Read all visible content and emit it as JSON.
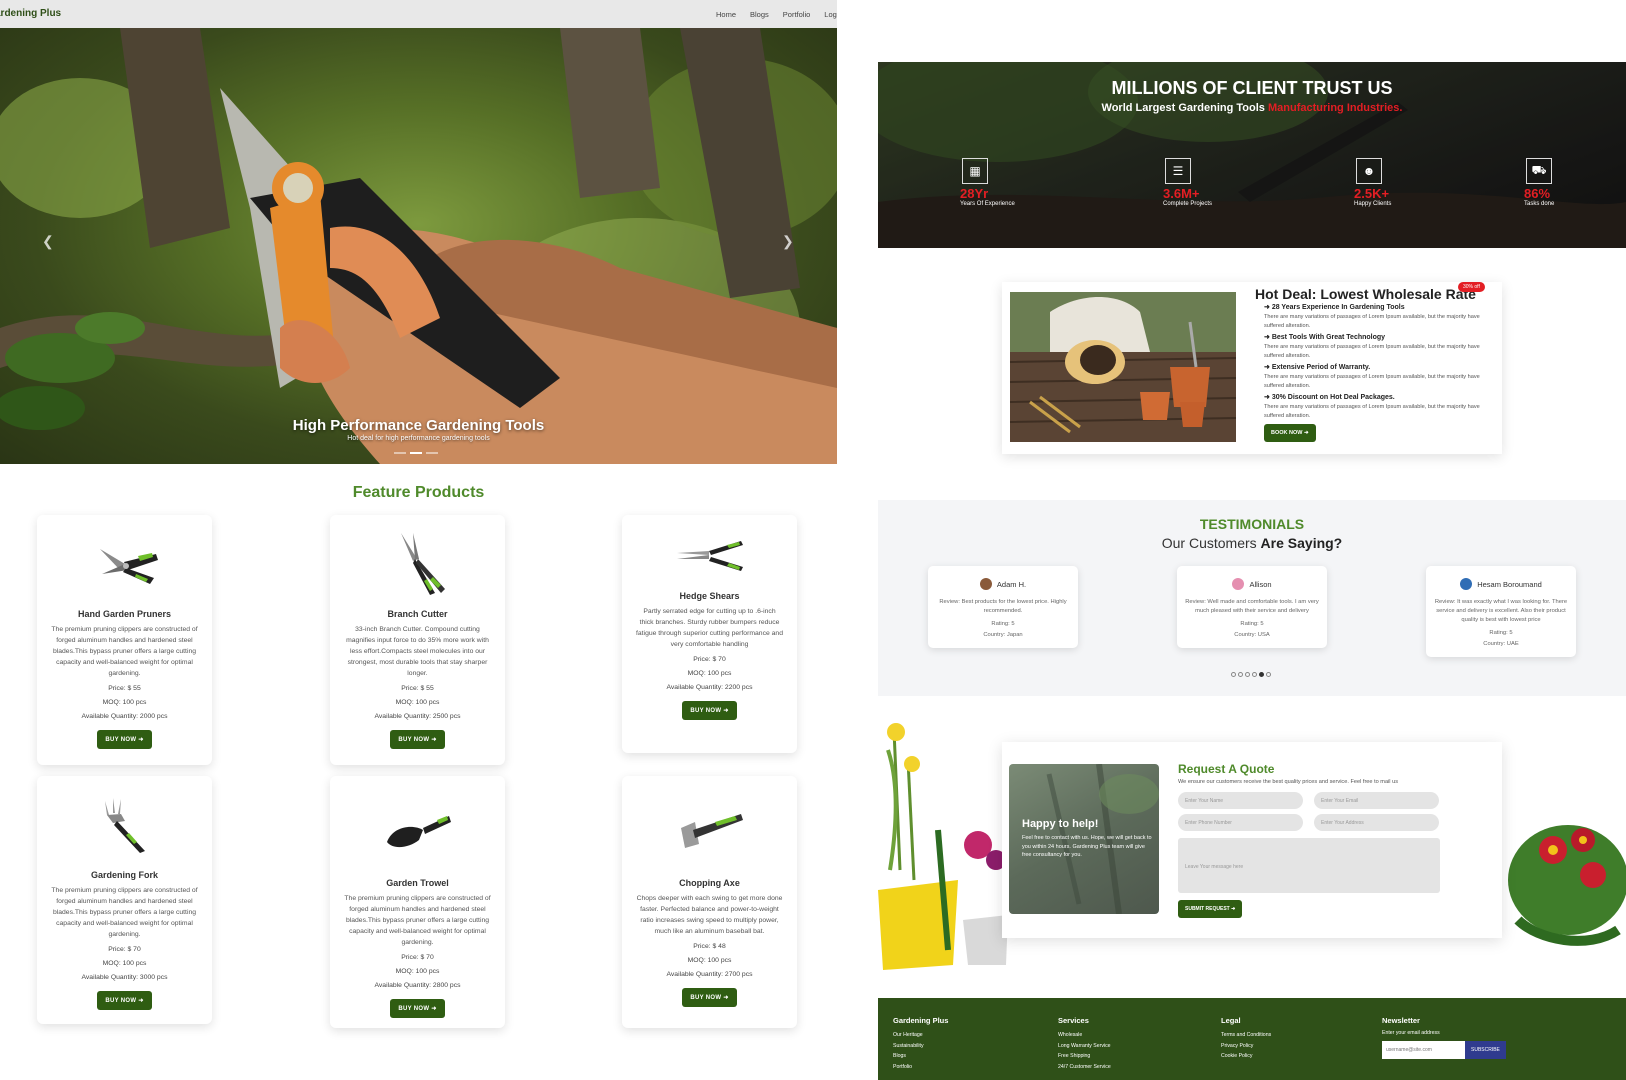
{
  "nav": {
    "brand": "ardening Plus",
    "links": [
      "Home",
      "Blogs",
      "Portfolio",
      "Logi"
    ]
  },
  "hero": {
    "title": "High Performance Gardening Tools",
    "subtitle": "Hot deal for high performance gardening tools",
    "prev_icon": "chevron-left-icon",
    "next_icon": "chevron-right-icon"
  },
  "features": {
    "title": "Feature Products",
    "buy_label": "BUY NOW",
    "products": [
      {
        "name": "Hand Garden Pruners",
        "desc": "The premium pruning clippers are constructed of forged aluminum handles and hardened steel blades.This bypass pruner offers a large cutting capacity and well-balanced weight for optimal gardening.",
        "price": "Price: $ 55",
        "moq": "MOQ: 100 pcs",
        "qty": "Available Quantity: 2000 pcs",
        "icon": "pruner-icon"
      },
      {
        "name": "Branch Cutter",
        "desc": "33-inch Branch Cutter. Compound cutting magnifies input force to do 35% more work with less effort.Compacts steel molecules into our strongest, most durable tools that stay sharper longer.",
        "price": "Price: $ 55",
        "moq": "MOQ: 100 pcs",
        "qty": "Available Quantity: 2500 pcs",
        "icon": "lopper-icon"
      },
      {
        "name": "Hedge Shears",
        "desc": "Partly serrated edge for cutting up to .6-inch thick branches. Sturdy rubber bumpers reduce fatigue through superior cutting performance and very comfortable handling",
        "price": "Price: $ 70",
        "moq": "MOQ: 100 pcs",
        "qty": "Available Quantity: 2200 pcs",
        "icon": "shears-icon"
      },
      {
        "name": "Gardening Fork",
        "desc": "The premium pruning clippers are constructed of forged aluminum handles and hardened steel blades.This bypass pruner offers a large cutting capacity and well-balanced weight for optimal gardening.",
        "price": "Price: $ 70",
        "moq": "MOQ: 100 pcs",
        "qty": "Available Quantity: 3000 pcs",
        "icon": "fork-icon"
      },
      {
        "name": "Garden Trowel",
        "desc": "The premium pruning clippers are constructed of forged aluminum handles and hardened steel blades.This bypass pruner offers a large cutting capacity and well-balanced weight for optimal gardening.",
        "price": "Price: $ 70",
        "moq": "MOQ: 100 pcs",
        "qty": "Available Quantity: 2800 pcs",
        "icon": "trowel-icon"
      },
      {
        "name": "Chopping Axe",
        "desc": "Chops deeper with each swing to get more done faster. Perfected balance and power-to-weight ratio increases swing speed to multiply power, much like an aluminum baseball bat.",
        "price": "Price: $ 48",
        "moq": "MOQ: 100 pcs",
        "qty": "Available Quantity: 2700 pcs",
        "icon": "axe-icon"
      }
    ]
  },
  "stats": {
    "title": "MILLIONS OF CLIENT TRUST US",
    "subtitle_white": "World Largest Gardening Tools ",
    "subtitle_red": "Manufacturing Industries.",
    "items": [
      {
        "value": "28Yr",
        "label": "Years Of Experience",
        "icon": "calendar-icon"
      },
      {
        "value": "3.6M+",
        "label": "Complete Projects",
        "icon": "list-icon"
      },
      {
        "value": "2.5K+",
        "label": "Happy Clients",
        "icon": "users-icon"
      },
      {
        "value": "86%",
        "label": "Tasks done",
        "icon": "truck-icon"
      }
    ]
  },
  "deal": {
    "title": "Hot Deal: Lowest Wholesale Rate",
    "badge": "30% off",
    "points": [
      {
        "heading": "28 Years Experience In Gardening Tools",
        "text": "There are many variations of passages of Lorem Ipsum available, but the majority have suffered alteration."
      },
      {
        "heading": "Best Tools With Great Technology",
        "text": "There are many variations of passages of Lorem Ipsum available, but the majority have suffered alteration."
      },
      {
        "heading": "Extensive Period of Warranty.",
        "text": "There are many variations of passages of Lorem Ipsum available, but the majority have suffered alteration."
      },
      {
        "heading": "30% Discount on Hot Deal Packages.",
        "text": "There are many variations of passages of Lorem Ipsum available, but the majority have suffered alteration."
      }
    ],
    "button": "BOOK NOW"
  },
  "testimonials": {
    "heading": "TESTIMONIALS",
    "sub_plain": "Our Customers ",
    "sub_bold": "Are Saying?",
    "items": [
      {
        "name": "Adam H.",
        "review": "Review: Best products for the lowest price. Highly recommended.",
        "rating": "Rating: 5",
        "country": "Country: Japan"
      },
      {
        "name": "Allison",
        "review": "Review: Well made and comfortable tools. I am very much pleased with their service and delivery",
        "rating": "Rating: 5",
        "country": "Country: USA"
      },
      {
        "name": "Hesam Boroumand",
        "review": "Review: It was exactly what I was looking for. There service and delivery is excellent. Also their product quality is best with lowest price",
        "rating": "Rating: 5",
        "country": "Country: UAE"
      }
    ]
  },
  "quote": {
    "help_title": "Happy to help!",
    "help_text": "Feel free to contact with us. Hope, we will get back to you within 24 hours. Gardening Plus team will give free consultancy for you.",
    "title": "Request A Quote",
    "subtitle": "We ensure our customers receive the best quality prices and service. Feel free to mail us",
    "ph_name": "Enter Your Name",
    "ph_email": "Enter Your Email",
    "ph_phone": "Enter Phone Number",
    "ph_address": "Enter Your Address",
    "ph_message": "Leave Your message here",
    "button": "SUBMIT REQUEST"
  },
  "footer": {
    "col1": {
      "title": "Gardening Plus",
      "links": [
        "Our Heritage",
        "Sustainability",
        "Blogs",
        "Portfolio"
      ]
    },
    "col2": {
      "title": "Services",
      "links": [
        "Wholesale",
        "Long Warranty Service",
        "Free Shipping",
        "24/7 Customer Service"
      ]
    },
    "col3": {
      "title": "Legal",
      "links": [
        "Terms and Conditions",
        "Privacy Policy",
        "Cookie Policy"
      ]
    },
    "newsletter": {
      "title": "Newsletter",
      "label": "Enter your email address",
      "placeholder": "username@site.com",
      "button": "SUBSCRIBE"
    }
  },
  "colors": {
    "brand_green": "#2f5d12",
    "accent_green": "#4f8a2b",
    "accent_red": "#e31e24",
    "footer_green": "#2f5018"
  }
}
